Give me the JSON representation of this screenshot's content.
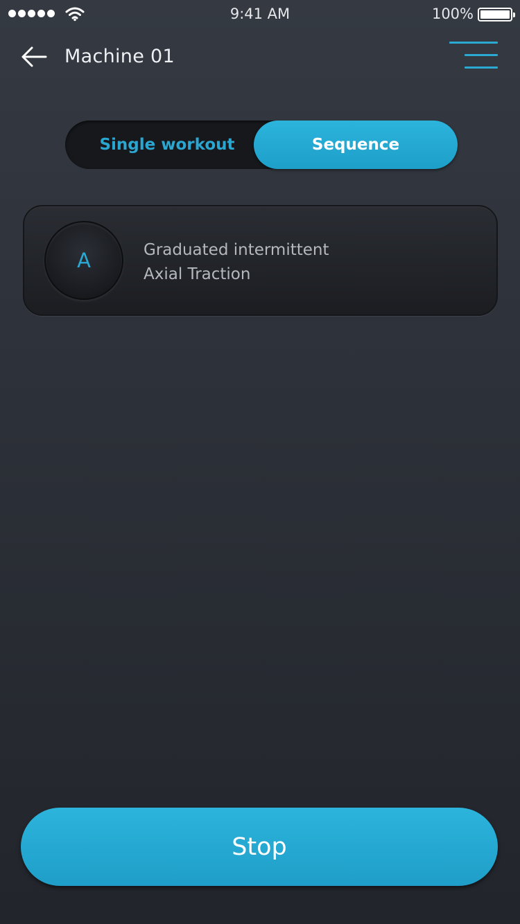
{
  "status_bar": {
    "time": "9:41 AM",
    "battery_percent": "100%",
    "signal_bars": 5,
    "icons": [
      "signal-icon",
      "wifi-icon",
      "battery-icon"
    ]
  },
  "header": {
    "title": "Machine 01",
    "back_icon": "arrow-left-icon",
    "menu_icon": "menu-icon"
  },
  "mode_toggle": {
    "tabs": [
      {
        "label": "Single workout",
        "active": false
      },
      {
        "label": "Sequence",
        "active": true
      }
    ]
  },
  "workouts": [
    {
      "badge": "A",
      "line1": "Graduated intermittent",
      "line2": "Axial Traction"
    }
  ],
  "actions": {
    "stop_label": "Stop"
  },
  "colors": {
    "accent": "#2aa9d3",
    "background_top": "#353a42",
    "background_bottom": "#22252b",
    "card_text": "#b5b8be"
  }
}
